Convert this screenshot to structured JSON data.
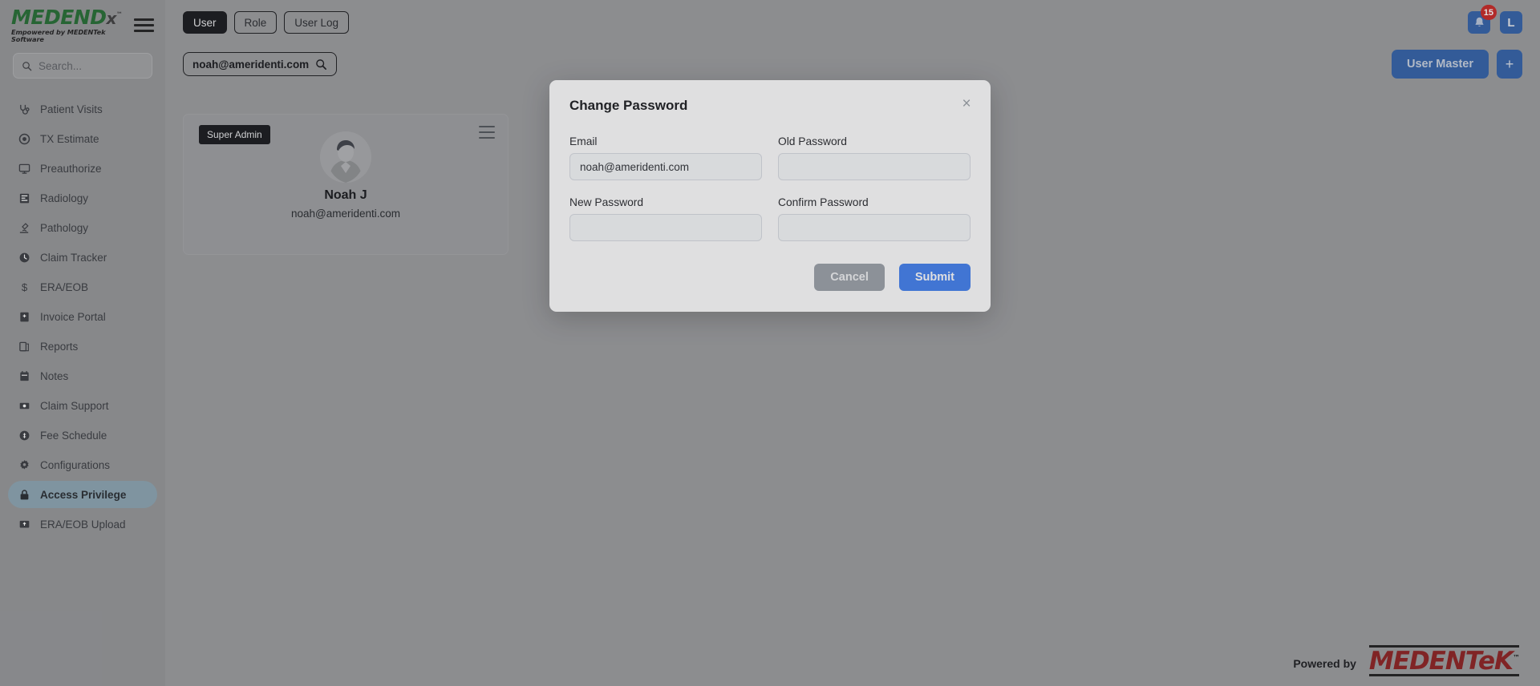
{
  "brand": {
    "name_main": "MEDEND",
    "name_x": "x",
    "tm": "™",
    "tagline": "Empowered by MEDENTek Software"
  },
  "sidebar": {
    "search_placeholder": "Search...",
    "items": [
      {
        "label": "Patient Visits",
        "icon": "stethoscope-icon",
        "active": false
      },
      {
        "label": "TX Estimate",
        "icon": "target-icon",
        "active": false
      },
      {
        "label": "Preauthorize",
        "icon": "monitor-icon",
        "active": false
      },
      {
        "label": "Radiology",
        "icon": "xray-icon",
        "active": false
      },
      {
        "label": "Pathology",
        "icon": "microscope-icon",
        "active": false
      },
      {
        "label": "Claim Tracker",
        "icon": "clock-icon",
        "active": false
      },
      {
        "label": "ERA/EOB",
        "icon": "dollar-icon",
        "active": false
      },
      {
        "label": "Invoice Portal",
        "icon": "invoice-icon",
        "active": false
      },
      {
        "label": "Reports",
        "icon": "report-icon",
        "active": false
      },
      {
        "label": "Notes",
        "icon": "notes-icon",
        "active": false
      },
      {
        "label": "Claim Support",
        "icon": "support-icon",
        "active": false
      },
      {
        "label": "Fee Schedule",
        "icon": "coin-icon",
        "active": false
      },
      {
        "label": "Configurations",
        "icon": "gear-icon",
        "active": false
      },
      {
        "label": "Access Privilege",
        "icon": "lock-icon",
        "active": true
      },
      {
        "label": "ERA/EOB Upload",
        "icon": "upload-icon",
        "active": false
      }
    ]
  },
  "topbar": {
    "tabs": [
      {
        "label": "User",
        "active": true
      },
      {
        "label": "Role",
        "active": false
      },
      {
        "label": "User Log",
        "active": false
      }
    ],
    "notification_count": "15",
    "avatar_initial": "L"
  },
  "subheader": {
    "search_value": "noah@ameridenti.com",
    "user_master_label": "User Master",
    "add_label": "+"
  },
  "user_card": {
    "role_badge": "Super Admin",
    "name": "Noah J",
    "email": "noah@ameridenti.com"
  },
  "modal": {
    "title": "Change Password",
    "close_label": "×",
    "fields": [
      {
        "label": "Email",
        "value": "noah@ameridenti.com",
        "placeholder": ""
      },
      {
        "label": "Old Password",
        "value": "",
        "placeholder": ""
      },
      {
        "label": "New Password",
        "value": "",
        "placeholder": ""
      },
      {
        "label": "Confirm Password",
        "value": "",
        "placeholder": ""
      }
    ],
    "cancel_label": "Cancel",
    "submit_label": "Submit"
  },
  "footer": {
    "powered_by": "Powered by",
    "vendor": "MEDENTeK",
    "vendor_tm": "™"
  },
  "colors": {
    "brand_green": "#1f6b2e",
    "accent_blue": "#2e5fa8",
    "submit_blue": "#3f7ef0",
    "cancel_gray": "#9aa0a8",
    "badge_red": "#c8231f",
    "active_nav": "#8aa4b1",
    "vendor_red": "#8c1b1b"
  }
}
